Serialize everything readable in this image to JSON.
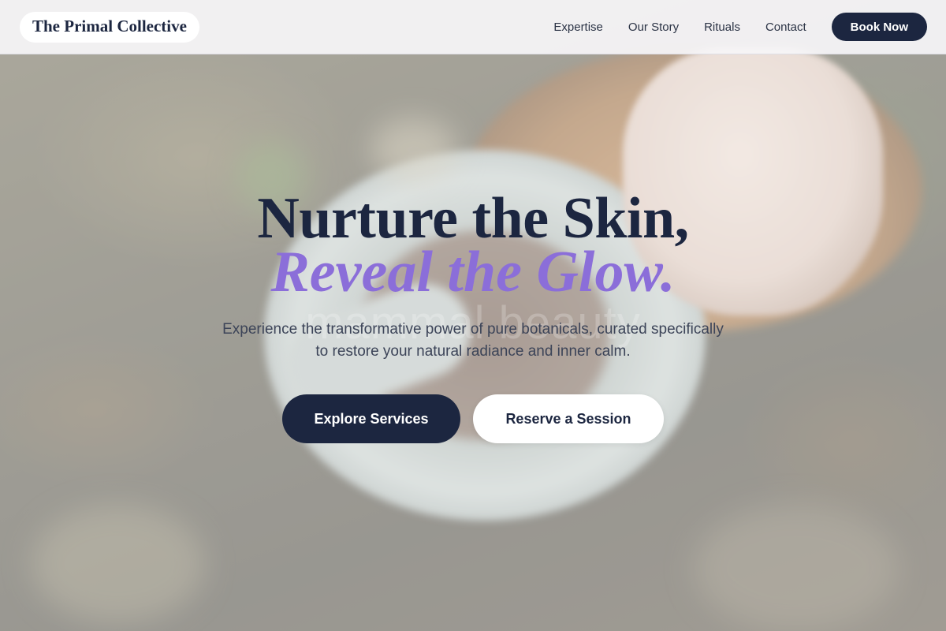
{
  "brand": {
    "name": "The Primal Collective"
  },
  "nav": {
    "links": [
      "Expertise",
      "Our Story",
      "Rituals",
      "Contact"
    ],
    "cta_label": "Book Now"
  },
  "hero": {
    "headline_line1": "Nurture the Skin,",
    "headline_line2": "Reveal the Glow.",
    "watermark": "mammal beauty",
    "subtext": "Experience the transformative power of pure botanicals, curated specifically to restore your natural radiance and inner calm.",
    "primary_cta": "Explore Services",
    "secondary_cta": "Reserve a Session"
  },
  "colors": {
    "navy": "#1c2640",
    "accent_purple": "#8b6ed9",
    "header_bg": "#f6f5f8",
    "white": "#ffffff"
  }
}
